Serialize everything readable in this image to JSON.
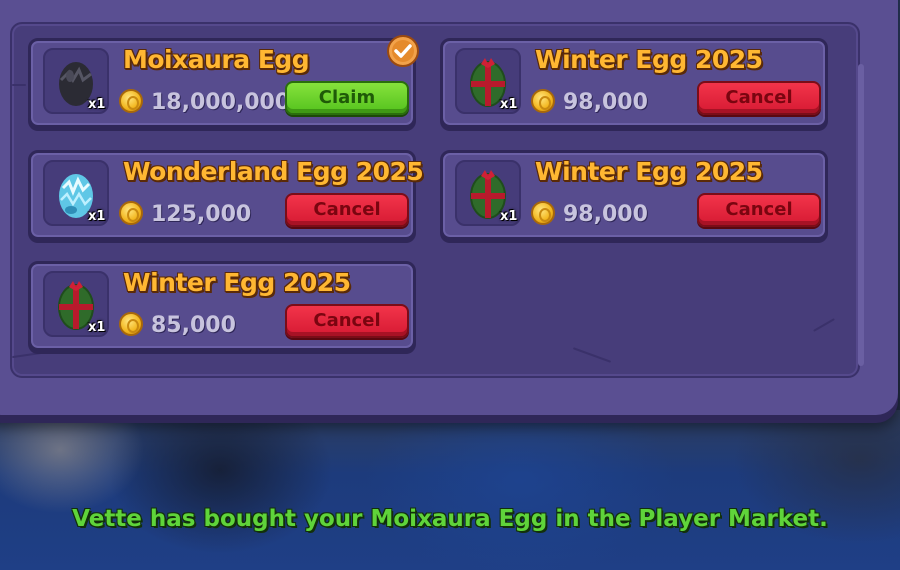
{
  "listings": [
    {
      "item": "Moixaura Egg",
      "quantity": "x1",
      "price": "18,000,000",
      "action": "Claim",
      "sold": true,
      "egg_icon": "dark-egg-icon"
    },
    {
      "item": "Winter Egg 2025",
      "quantity": "x1",
      "price": "98,000",
      "action": "Cancel",
      "sold": false,
      "egg_icon": "winter-egg-icon"
    },
    {
      "item": "Wonderland Egg 2025",
      "quantity": "x1",
      "price": "125,000",
      "action": "Cancel",
      "sold": false,
      "egg_icon": "crystal-egg-icon"
    },
    {
      "item": "Winter Egg 2025",
      "quantity": "x1",
      "price": "98,000",
      "action": "Cancel",
      "sold": false,
      "egg_icon": "winter-egg-icon"
    },
    {
      "item": "Winter Egg 2025",
      "quantity": "x1",
      "price": "85,000",
      "action": "Cancel",
      "sold": false,
      "egg_icon": "winter-egg-icon"
    }
  ],
  "notification": "Vette has bought your Moixaura Egg in the Player Market.",
  "colors": {
    "item_name": "#ffb732",
    "claim_button": "#54c21d",
    "cancel_button": "#d61a33",
    "notification_text": "#5fd43a",
    "panel": "#5a4f92"
  },
  "icons": {
    "currency": "gold-coin-icon",
    "sold": "checkmark-icon"
  }
}
